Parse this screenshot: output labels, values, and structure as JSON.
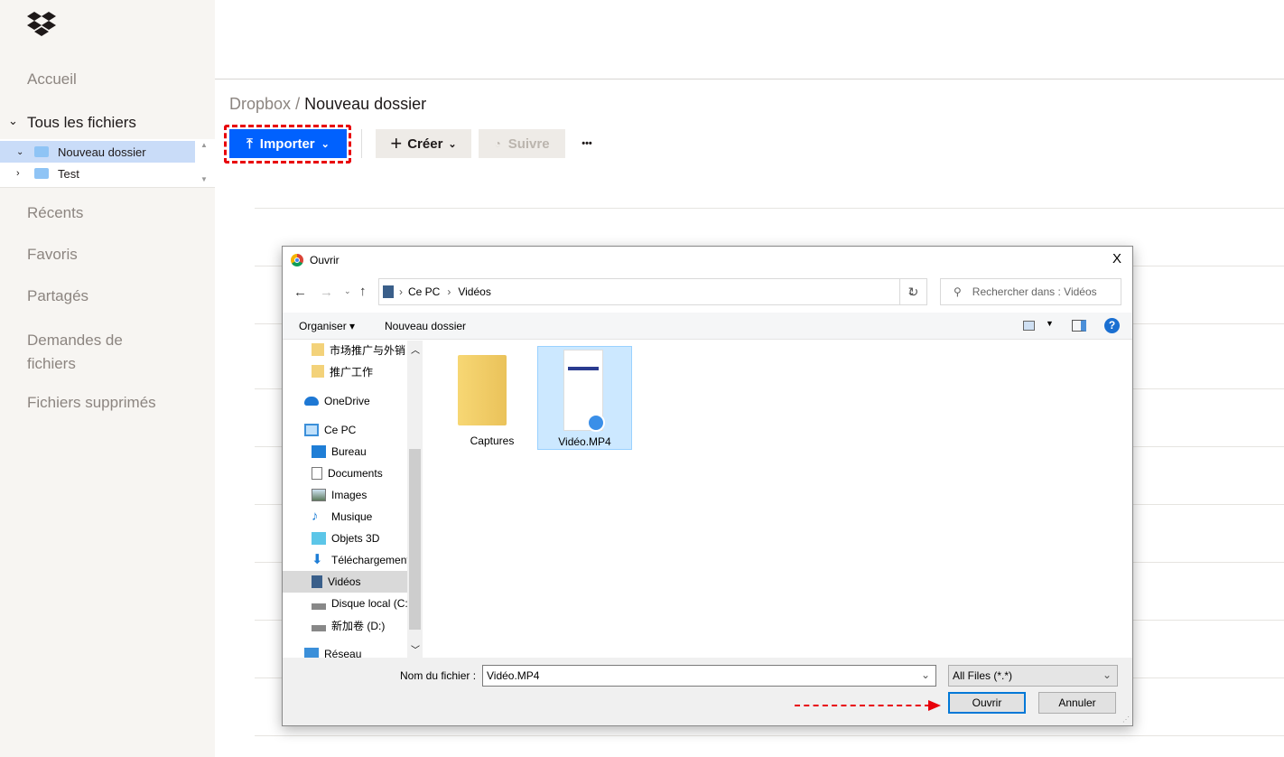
{
  "sidebar": {
    "nav": [
      "Accueil",
      "Tous les fichiers",
      "Récents",
      "Favoris",
      "Partagés",
      "Demandes de fichiers",
      "Fichiers supprimés"
    ],
    "tree": [
      "Nouveau dossier",
      "Test"
    ]
  },
  "breadcrumb": {
    "root": "Dropbox",
    "sep": "/",
    "current": "Nouveau dossier"
  },
  "toolbar": {
    "import": "Importer",
    "create": "Créer",
    "follow": "Suivre",
    "more": "•••"
  },
  "dialog": {
    "title": "Ouvrir",
    "close": "X",
    "path": [
      "Ce PC",
      "Vidéos"
    ],
    "search_placeholder": "Rechercher dans : Vidéos",
    "organise": "Organiser ▾",
    "new_folder": "Nouveau dossier",
    "nav_items": [
      "市场推广与外销",
      "推广工作",
      "OneDrive",
      "Ce PC",
      "Bureau",
      "Documents",
      "Images",
      "Musique",
      "Objets 3D",
      "Téléchargements",
      "Vidéos",
      "Disque local (C:)",
      "新加卷 (D:)",
      "Réseau"
    ],
    "files": [
      "Captures",
      "Vidéo.MP4"
    ],
    "filename_label": "Nom du fichier :",
    "filename": "Vidéo.MP4",
    "filter": "All Files (*.*)",
    "open": "Ouvrir",
    "cancel": "Annuler"
  },
  "colors": {
    "accent": "#0061fe",
    "highlight": "#e8000b"
  }
}
